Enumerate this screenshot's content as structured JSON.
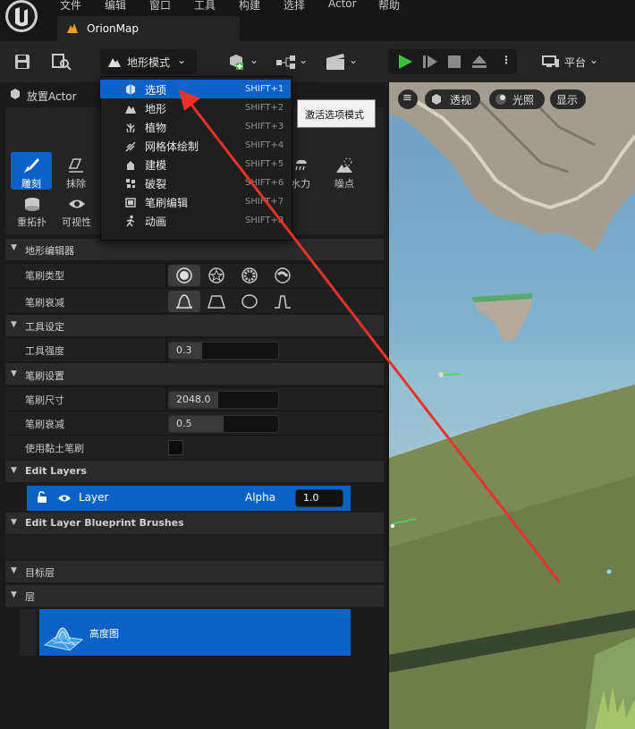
{
  "menu": [
    "文件",
    "编辑",
    "窗口",
    "工具",
    "构建",
    "选择",
    "Actor",
    "帮助"
  ],
  "tab": {
    "title": "OrionMap"
  },
  "toolbar": {
    "mode_label": "地形模式",
    "platform_label": "平台"
  },
  "left_panel": {
    "title": "放置Actor",
    "tools": [
      {
        "label": "雕刻",
        "icon": "sculpt-icon"
      },
      {
        "label": "抹除",
        "icon": "erase-icon"
      },
      {
        "label": "水力",
        "icon": "hydro-icon"
      },
      {
        "label": "噪点",
        "icon": "noise-icon"
      },
      {
        "label": "重拓扑",
        "icon": "retopo-icon"
      },
      {
        "label": "可视性",
        "icon": "visibility-icon"
      }
    ],
    "landscape_editor": {
      "title": "地形编辑器",
      "brush_type_label": "笔刷类型",
      "brush_falloff_label": "笔刷衰减"
    },
    "tool_settings": {
      "title": "工具设定",
      "strength_label": "工具强度",
      "strength_value": "0.3",
      "strength_fraction": 0.3
    },
    "brush_settings": {
      "title": "笔刷设置",
      "size_label": "笔刷尺寸",
      "size_value": "2048.0",
      "size_fraction": 0.45,
      "falloff_label": "笔刷衰减",
      "falloff_value": "0.5",
      "falloff_fraction": 0.5,
      "clay_label": "使用黏土笔刷"
    },
    "edit_layers": {
      "title": "Edit Layers",
      "layer_name": "Layer",
      "alpha_label": "Alpha",
      "alpha_value": "1.0"
    },
    "blueprint_brushes": {
      "title": "Edit Layer Blueprint Brushes"
    },
    "target_layers": {
      "title": "目标层"
    },
    "layers": {
      "title": "层",
      "heightmap_label": "高度图"
    }
  },
  "dropdown": {
    "items": [
      {
        "label": "选项",
        "shortcut": "SHIFT+1"
      },
      {
        "label": "地形",
        "shortcut": "SHIFT+2"
      },
      {
        "label": "植物",
        "shortcut": "SHIFT+3"
      },
      {
        "label": "网格体绘制",
        "shortcut": "SHIFT+4"
      },
      {
        "label": "建模",
        "shortcut": "SHIFT+5"
      },
      {
        "label": "破裂",
        "shortcut": "SHIFT+6"
      },
      {
        "label": "笔刷编辑",
        "shortcut": "SHIFT+7"
      },
      {
        "label": "动画",
        "shortcut": "SHIFT+8"
      }
    ],
    "tooltip": "激活选项模式"
  },
  "viewport": {
    "perspective_label": "透视",
    "lit_label": "光照",
    "show_label": "显示"
  },
  "colors": {
    "accent": "#0a62c8",
    "play": "#3ec03e",
    "annotation": "#e8322a"
  }
}
